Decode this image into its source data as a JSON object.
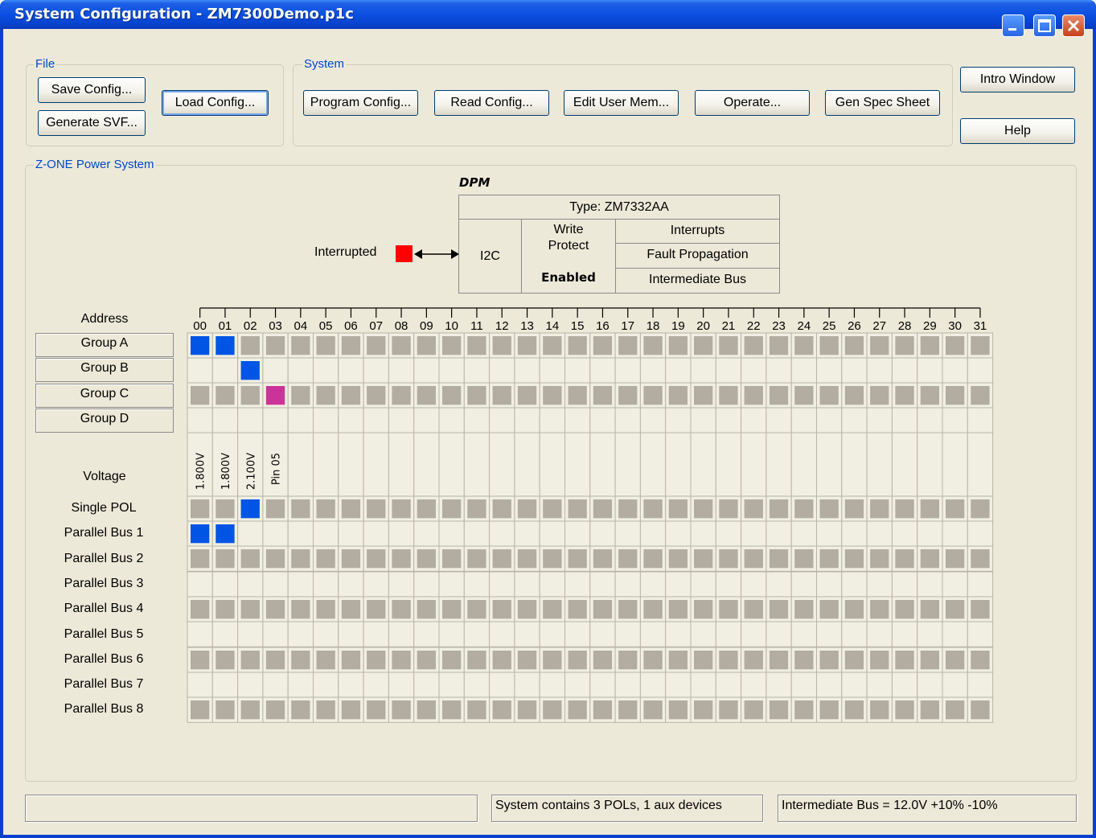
{
  "window": {
    "title": "System Configuration - ZM7300Demo.p1c",
    "controls": {
      "minimize": "minimize-icon",
      "maximize": "maximize-icon",
      "close": "close-icon"
    }
  },
  "file_group": {
    "label": "File",
    "save_config": "Save Config...",
    "generate_svf": "Generate SVF...",
    "load_config": "Load Config..."
  },
  "system_group": {
    "label": "System",
    "program_config": "Program Config...",
    "read_config": "Read Config...",
    "edit_user_mem": "Edit User Mem...",
    "operate": "Operate...",
    "gen_spec_sheet": "Gen Spec Sheet"
  },
  "side_buttons": {
    "intro_window": "Intro Window",
    "help": "Help"
  },
  "power_system": {
    "label": "Z-ONE Power System",
    "dpm": {
      "title": "DPM",
      "type": "Type: ZM7332AA",
      "i2c": "I2C",
      "write_protect": "Write\nProtect",
      "write_protect_state": "Enabled",
      "interrupts": "Interrupts",
      "fault_propagation": "Fault Propagation",
      "intermediate_bus": "Intermediate Bus",
      "interrupted_label": "Interrupted",
      "interrupted_color": "#ff0000"
    },
    "address_label": "Address",
    "addresses": [
      "00",
      "01",
      "02",
      "03",
      "04",
      "05",
      "06",
      "07",
      "08",
      "09",
      "10",
      "11",
      "12",
      "13",
      "14",
      "15",
      "16",
      "17",
      "18",
      "19",
      "20",
      "21",
      "22",
      "23",
      "24",
      "25",
      "26",
      "27",
      "28",
      "29",
      "30",
      "31"
    ],
    "group_labels": [
      "Group A",
      "Group B",
      "Group C",
      "Group D"
    ],
    "voltage_label": "Voltage",
    "voltages": [
      "1.800V",
      "1.800V",
      "2.100V",
      "Pin 05"
    ],
    "bus_labels": [
      "Single POL",
      "Parallel Bus 1",
      "Parallel Bus 2",
      "Parallel Bus 3",
      "Parallel Bus 4",
      "Parallel Bus 5",
      "Parallel Bus 6",
      "Parallel Bus 7",
      "Parallel Bus 8"
    ],
    "colors": {
      "active": "#0055e5",
      "aux": "#cc3399",
      "inactive": "#b2ada0"
    },
    "matrix": {
      "Group A": {
        "shaded": true,
        "active": [
          0,
          1
        ],
        "aux": []
      },
      "Group B": {
        "shaded": false,
        "active": [
          2
        ],
        "aux": []
      },
      "Group C": {
        "shaded": true,
        "active": [],
        "aux": [
          3
        ]
      },
      "Group D": {
        "shaded": false,
        "active": [],
        "aux": []
      },
      "Single POL": {
        "shaded": true,
        "active": [
          2
        ],
        "aux": []
      },
      "Parallel Bus 1": {
        "shaded": false,
        "active": [
          0,
          1
        ],
        "aux": []
      },
      "Parallel Bus 2": {
        "shaded": true,
        "active": [],
        "aux": []
      },
      "Parallel Bus 3": {
        "shaded": false,
        "active": [],
        "aux": []
      },
      "Parallel Bus 4": {
        "shaded": true,
        "active": [],
        "aux": []
      },
      "Parallel Bus 5": {
        "shaded": false,
        "active": [],
        "aux": []
      },
      "Parallel Bus 6": {
        "shaded": true,
        "active": [],
        "aux": []
      },
      "Parallel Bus 7": {
        "shaded": false,
        "active": [],
        "aux": []
      },
      "Parallel Bus 8": {
        "shaded": true,
        "active": [],
        "aux": []
      }
    }
  },
  "status_bar": {
    "left": "",
    "middle": "System contains 3 POLs, 1 aux devices",
    "right": "Intermediate Bus = 12.0V +10% -10%"
  }
}
